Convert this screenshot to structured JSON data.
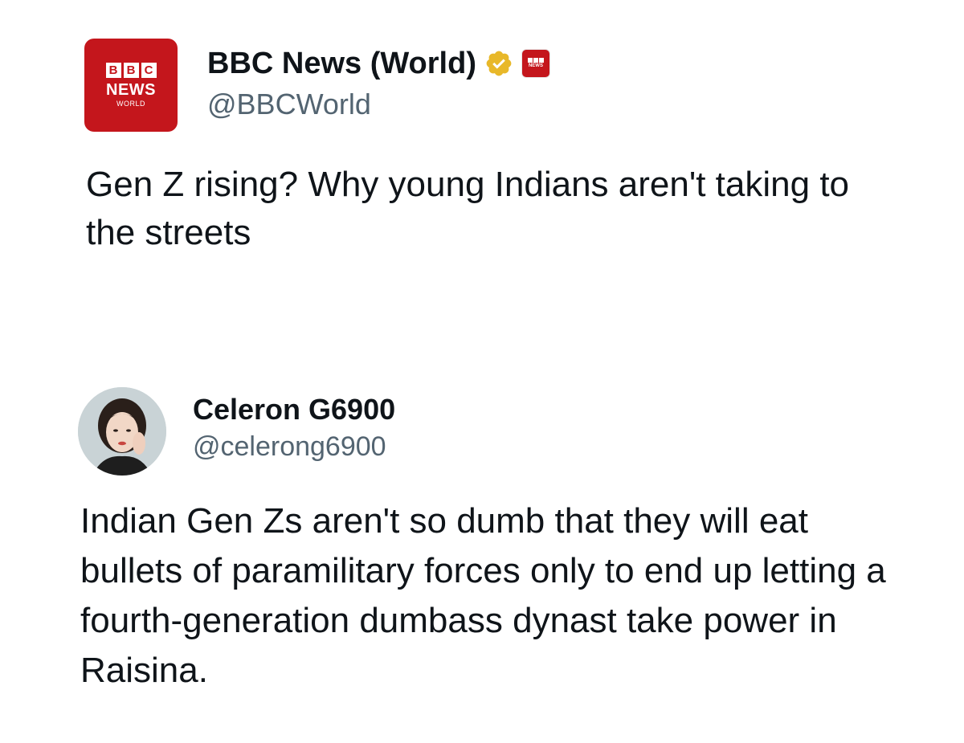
{
  "original_tweet": {
    "avatar": {
      "brand_blocks": [
        "B",
        "B",
        "C"
      ],
      "brand_name": "NEWS",
      "brand_sub": "WORLD",
      "color": "#c4161c"
    },
    "display_name": "BBC News (World)",
    "verified_icon": "gold-verified-checkmark-icon",
    "affiliate_badge": {
      "icon": "bbc-news-affiliate-badge-icon",
      "text": "NEWS"
    },
    "handle": "@BBCWorld",
    "text": "Gen Z rising? Why young Indians aren't taking to the streets"
  },
  "reply_tweet": {
    "avatar": {
      "icon": "profile-photo-avatar"
    },
    "display_name": "Celeron G6900",
    "handle": "@celerong6900",
    "text": "Indian Gen Zs aren't so dumb that they will eat bullets of paramilitary forces only to end up letting a fourth-generation dumbass dynast take power in Raisina."
  },
  "colors": {
    "text_primary": "#0f1419",
    "text_secondary": "#536471",
    "verified_gold": "#e8b829",
    "bbc_red": "#c4161c"
  }
}
